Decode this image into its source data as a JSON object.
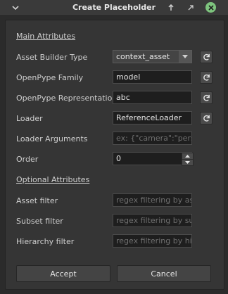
{
  "window": {
    "title": "Create Placeholder"
  },
  "main_attributes": {
    "header": "Main Attributes",
    "asset_builder_type": {
      "label": "Asset Builder Type",
      "value": "context_asset"
    },
    "openpype_family": {
      "label": "OpenPype Family",
      "value": "model"
    },
    "openpype_representation": {
      "label": "OpenPype Representation",
      "value": "abc"
    },
    "loader": {
      "label": "Loader",
      "value": "ReferenceLoader"
    },
    "loader_arguments": {
      "label": "Loader Arguments",
      "placeholder": "ex: {\"camera\":\"persp\"}"
    },
    "order": {
      "label": "Order",
      "value": "0"
    }
  },
  "optional_attributes": {
    "header": "Optional Attributes",
    "asset_filter": {
      "label": "Asset filter",
      "placeholder": "regex filtering by asset name"
    },
    "subset_filter": {
      "label": "Subset filter",
      "placeholder": "regex filtering by subset name"
    },
    "hierarchy_filter": {
      "label": "Hierarchy filter",
      "placeholder": "regex filtering by hierarchy"
    }
  },
  "buttons": {
    "accept": "Accept",
    "cancel": "Cancel"
  },
  "icons": {
    "collapse": "chevron-down-icon",
    "pin": "pin-icon",
    "float": "float-icon",
    "close": "close-icon",
    "refresh": "refresh-icon"
  },
  "colors": {
    "close_button": "#7ec47e",
    "background": "#2b2b2b",
    "panel": "#353535"
  }
}
